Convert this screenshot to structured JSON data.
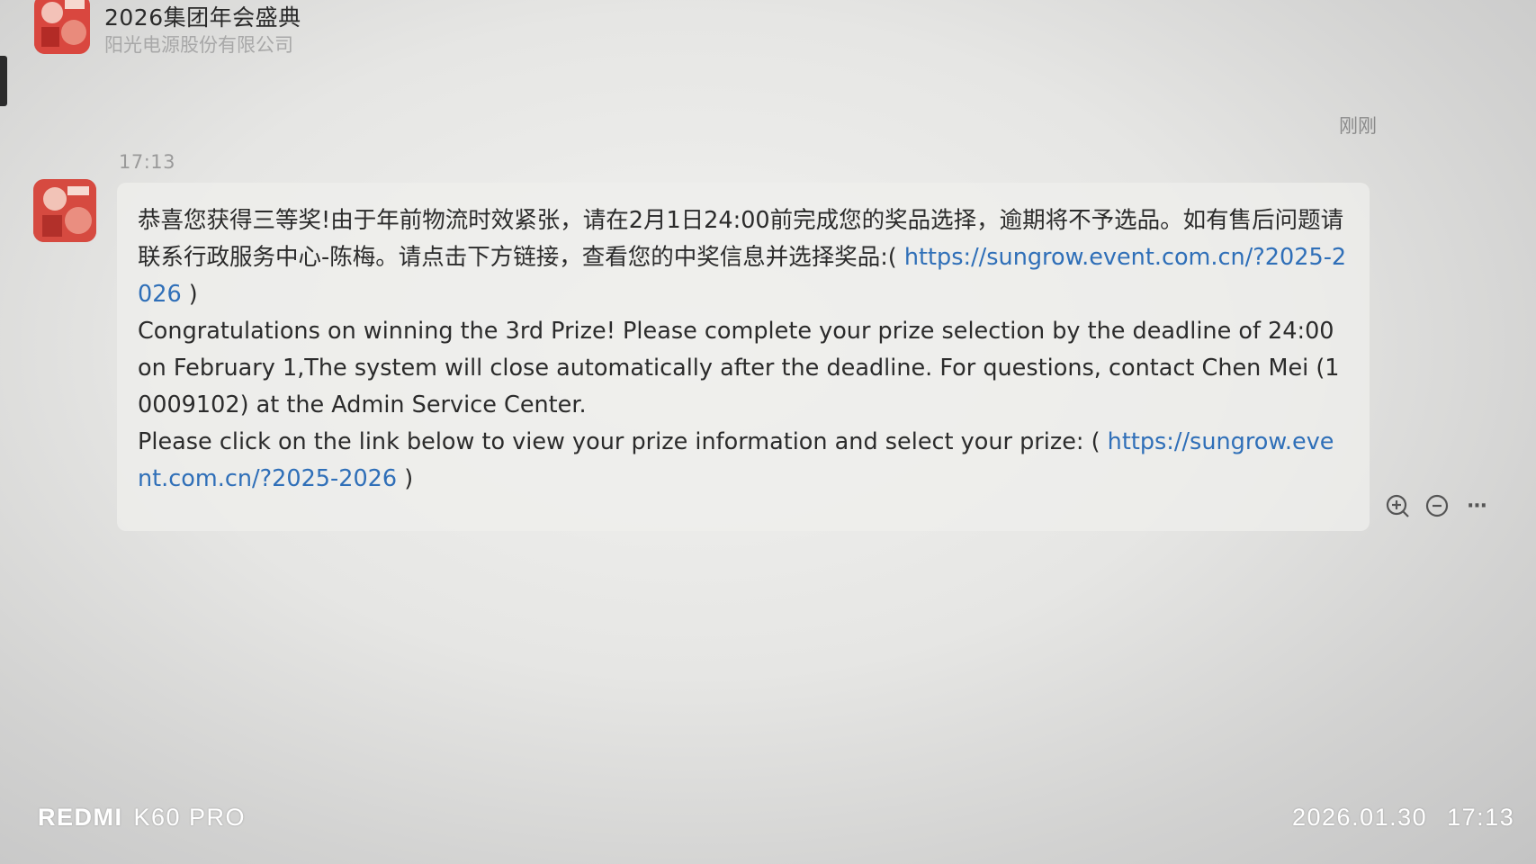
{
  "header": {
    "title": "2026集团年会盛典",
    "subtitle": "阳光电源股份有限公司"
  },
  "time_just_now": "刚刚",
  "message": {
    "time": "17:13",
    "cn_text": "恭喜您获得三等奖!由于年前物流时效紧张，请在2月1日24:00前完成您的奖品选择，逾期将不予选品。如有售后问题请联系行政服务中心-陈梅。请点击下方链接，查看您的中奖信息并选择奖品:(",
    "cn_link": "https://sungrow.event.com.cn/?2025-2026",
    "cn_close": ")",
    "en_text_1": "Congratulations on winning the 3rd Prize! Please complete your prize selection by the deadline of 24:00 on February 1,The system will close automatically after the deadline. For questions, contact Chen Mei (10009102) at the Admin Service Center.",
    "en_text_2": "Please click on the link below to view your prize information and select your prize: (",
    "en_link": "https://sungrow.event.com.cn/?2025-2026",
    "en_close": ")"
  },
  "actions": {
    "icons": [
      "search-add-icon",
      "comment-icon",
      "more-icon"
    ],
    "more_label": "···"
  },
  "watermark": {
    "brand": "REDMI",
    "model": "K60 PRO",
    "date": "2026.01.30",
    "time": "17:13"
  },
  "colors": {
    "link": "#2f6fb8",
    "text": "#2b2b2b",
    "muted": "#9a9a9a"
  }
}
